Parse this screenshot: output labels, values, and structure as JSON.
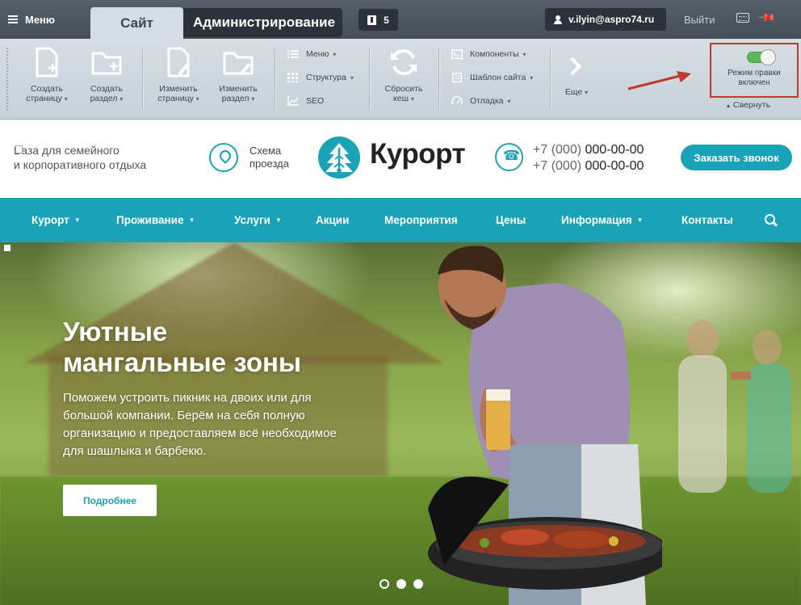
{
  "admin": {
    "menu_label": "Меню",
    "tab_site": "Сайт",
    "tab_admin": "Администрирование",
    "notifications_count": "5",
    "user_email": "v.ilyin@aspro74.ru",
    "exit_label": "Выйти"
  },
  "toolbar": {
    "create_page": [
      "Создать",
      "страницу"
    ],
    "create_section": [
      "Создать",
      "раздел"
    ],
    "edit_page": [
      "Изменить",
      "страницу"
    ],
    "edit_section": [
      "Изменить",
      "раздел"
    ],
    "menu": "Меню",
    "structure": "Структура",
    "seo": "SEO",
    "reset_cache": [
      "Сбросить",
      "кеш"
    ],
    "components": "Компоненты",
    "site_template": "Шаблон сайта",
    "debug": "Отладка",
    "more": "Еще",
    "edit_mode": [
      "Режим правки",
      "включен"
    ],
    "collapse": "Свернуть",
    "edit_mode_on": true
  },
  "header": {
    "tagline_1": "База для семейного",
    "tagline_2": "и корпоративного отдыха",
    "map_1": "Схема",
    "map_2": "проезда",
    "logo_text": "Курорт",
    "phone_1_prefix": "+7 (000)",
    "phone_1_number": "000-00-00",
    "phone_2_prefix": "+7 (000)",
    "phone_2_number": "000-00-00",
    "callback_label": "Заказать звонок"
  },
  "nav": {
    "items": [
      {
        "label": "Курорт",
        "dropdown": true
      },
      {
        "label": "Проживание",
        "dropdown": true
      },
      {
        "label": "Услуги",
        "dropdown": true
      },
      {
        "label": "Акции",
        "dropdown": false
      },
      {
        "label": "Мероприятия",
        "dropdown": false
      },
      {
        "label": "Цены",
        "dropdown": false
      },
      {
        "label": "Информация",
        "dropdown": true
      },
      {
        "label": "Контакты",
        "dropdown": false
      }
    ]
  },
  "hero": {
    "title_1": "Уютные",
    "title_2": "мангальные зоны",
    "text": "Поможем устроить пикник на двоих или для большой компании. Берём на себя полную организацию и предоставляем всё необходимое для шашлыка и барбекю.",
    "button_label": "Подробнее",
    "slides_total": 3,
    "active_slide": 1
  },
  "colors": {
    "accent": "#1aa3b7",
    "admin_dark": "#2b3239",
    "highlight_border": "#c0392b"
  }
}
